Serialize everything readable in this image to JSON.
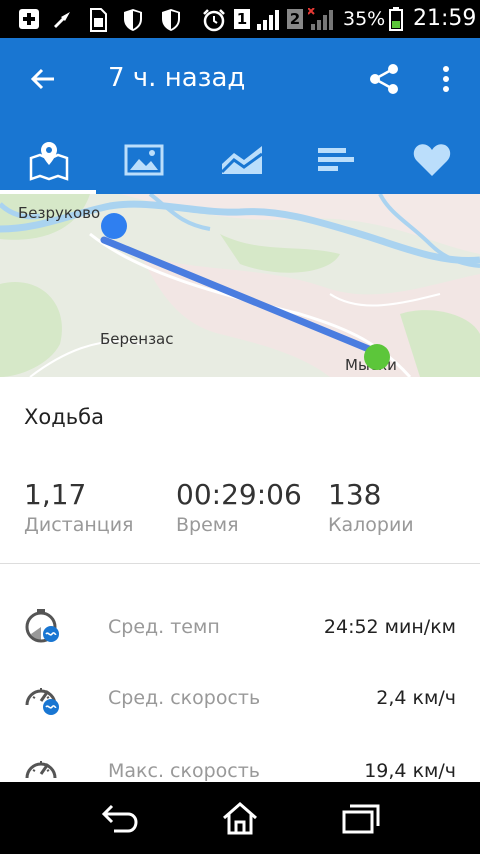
{
  "status_bar": {
    "sim1": "1",
    "sim2": "2",
    "battery_percent": "35%",
    "time": "21:59",
    "icons": [
      "add-box-icon",
      "usb-icon",
      "sim-card-icon",
      "shield-icon",
      "shield-icon",
      "alarm-icon",
      "signal-icon",
      "battery-icon"
    ]
  },
  "header": {
    "title": "7 ч. назад",
    "accent_color": "#1976d2"
  },
  "tabs": [
    {
      "icon": "map-icon",
      "selected": true
    },
    {
      "icon": "image-icon",
      "selected": false
    },
    {
      "icon": "chart-icon",
      "selected": false
    },
    {
      "icon": "bar-list-icon",
      "selected": false
    },
    {
      "icon": "heart-icon",
      "selected": false
    }
  ],
  "map": {
    "labels": {
      "start_place": "Безруково",
      "middle_place": "Берензас",
      "end_place": "Мыски"
    },
    "route_color": "#4a7de0",
    "start_marker_color": "#2f7ff0",
    "end_marker_color": "#5cc63a"
  },
  "activity": {
    "type": "Ходьба"
  },
  "stats": [
    {
      "value": "1,17",
      "label": "Дистанция"
    },
    {
      "value": "00:29:06",
      "label": "Время"
    },
    {
      "value": "138",
      "label": "Калории"
    }
  ],
  "details": [
    {
      "icon": "pace-icon",
      "label": "Сред. темп",
      "value": "24:52 мин/км"
    },
    {
      "icon": "speedometer-icon",
      "label": "Сред. скорость",
      "value": "2,4 км/ч"
    },
    {
      "icon": "speedometer-icon",
      "label": "Макс. скорость",
      "value": "19,4 км/ч"
    }
  ],
  "nav_bar": {
    "icons": [
      "back-icon",
      "home-icon",
      "recent-apps-icon"
    ]
  }
}
